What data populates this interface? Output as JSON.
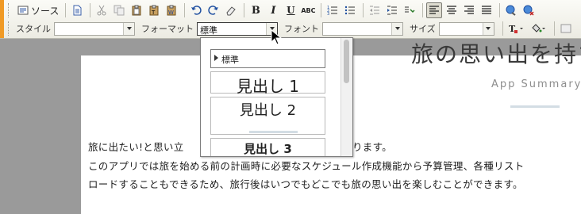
{
  "toolbar": {
    "source_label": "ソース",
    "style_label": "スタイル",
    "style_value": "",
    "format_label": "フォーマット",
    "format_value": "標準",
    "font_label": "フォント",
    "font_value": "",
    "size_label": "サイズ",
    "size_value": "",
    "bold_label": "B",
    "italic_label": "I",
    "underline_label": "U",
    "strike_label": "ABC"
  },
  "format_menu": {
    "items": [
      "標準",
      "見出し 1",
      "見出し 2",
      "見出し 3"
    ]
  },
  "document": {
    "title": "旅の思い出を持ち",
    "subtitle": "App Summary",
    "para1_start": "旅に出たい!と思い立",
    "para1_end": "ります。",
    "para2": "このアプリでは旅を始める前の計画時に必要なスケジュール作成機能から予算管理、各種リスト",
    "para3": "ロードすることもできるため、旅行後はいつでもどこでも旅の思い出を楽しむことができます。"
  },
  "colors": {
    "accent": "#f09a25",
    "toolbar_bg": "#f4f3ec",
    "page_bg": "#9a9a9a"
  }
}
